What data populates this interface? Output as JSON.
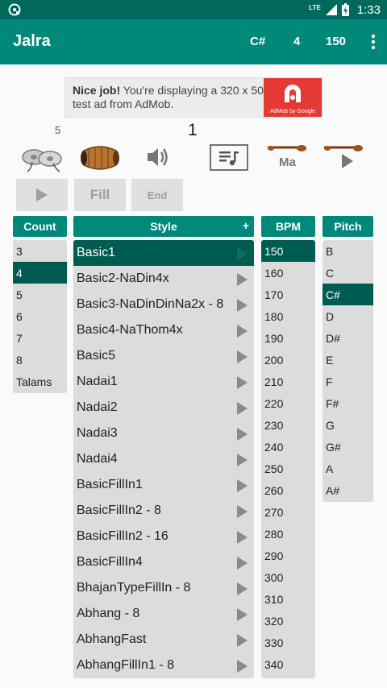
{
  "status": {
    "network": "LTE",
    "time": "1:33"
  },
  "app": {
    "title": "Jalra",
    "pitch": "C#",
    "count": "4",
    "bpm": "150"
  },
  "ad": {
    "bold": "Nice job!",
    "text": "You're displaying a 320 x 50 test ad from AdMob.",
    "brand": "AdMob by Google"
  },
  "counter_small": "5",
  "beat_counter": "1",
  "controls": {
    "play": "▶",
    "fill": "Fill",
    "end": "End"
  },
  "columns": {
    "count": "Count",
    "style": "Style",
    "style_add": "+",
    "bpm": "BPM",
    "pitch": "Pitch"
  },
  "count_items": [
    "3",
    "4",
    "5",
    "6",
    "7",
    "8",
    "Talams"
  ],
  "style_items": [
    "Basic1",
    "Basic2-NaDin4x",
    "Basic3-NaDinDinNa2x - 8",
    "Basic4-NaThom4x",
    "Basic5",
    "Nadai1",
    "Nadai2",
    "Nadai3",
    "Nadai4",
    "BasicFillIn1",
    "BasicFillIn2 - 8",
    "BasicFillIn2 - 16",
    "BasicFillIn4",
    "BhajanTypeFillIn - 8",
    "Abhang - 8",
    "AbhangFast",
    "AbhangFillIn1 - 8"
  ],
  "bpm_items": [
    "150",
    "160",
    "170",
    "180",
    "190",
    "200",
    "210",
    "220",
    "230",
    "240",
    "250",
    "260",
    "270",
    "280",
    "290",
    "300",
    "310",
    "320",
    "330",
    "340"
  ],
  "pitch_items": [
    "B",
    "C",
    "C#",
    "D",
    "D#",
    "E",
    "F",
    "F#",
    "G",
    "G#",
    "A",
    "A#"
  ],
  "icons": {
    "ma_label": "Ma"
  }
}
